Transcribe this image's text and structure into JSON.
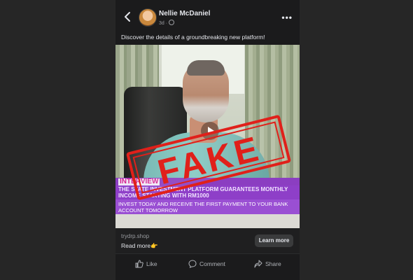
{
  "post": {
    "author": "Nellie McDaniel",
    "time": "3d ·",
    "more_label": "•••",
    "caption": "Discover the details of a groundbreaking new platform!",
    "stamp_text": "FAKE",
    "banner": {
      "tag": "INTERVIEW",
      "headline": "THE STATE INVESTMENT PLATFORM GUARANTEES MONTHLY INCOME STARTING WITH RM1000",
      "sub": "INVEST TODAY AND RECEIVE THE FIRST PAYMENT TO YOUR BANK ACCOUNT TOMORROW"
    },
    "link": {
      "domain": "trydrp.shop",
      "read_more": "Read more👉",
      "cta": "Learn more"
    },
    "actions": {
      "like": "Like",
      "comment": "Comment",
      "share": "Share"
    }
  },
  "icons": [
    "back-icon",
    "globe-icon",
    "more-icon",
    "play-icon",
    "like-icon",
    "comment-icon",
    "share-icon"
  ],
  "colors": {
    "stamp": "#e0201a",
    "banner": "#8e3fc8",
    "background": "#1b1b1c"
  }
}
